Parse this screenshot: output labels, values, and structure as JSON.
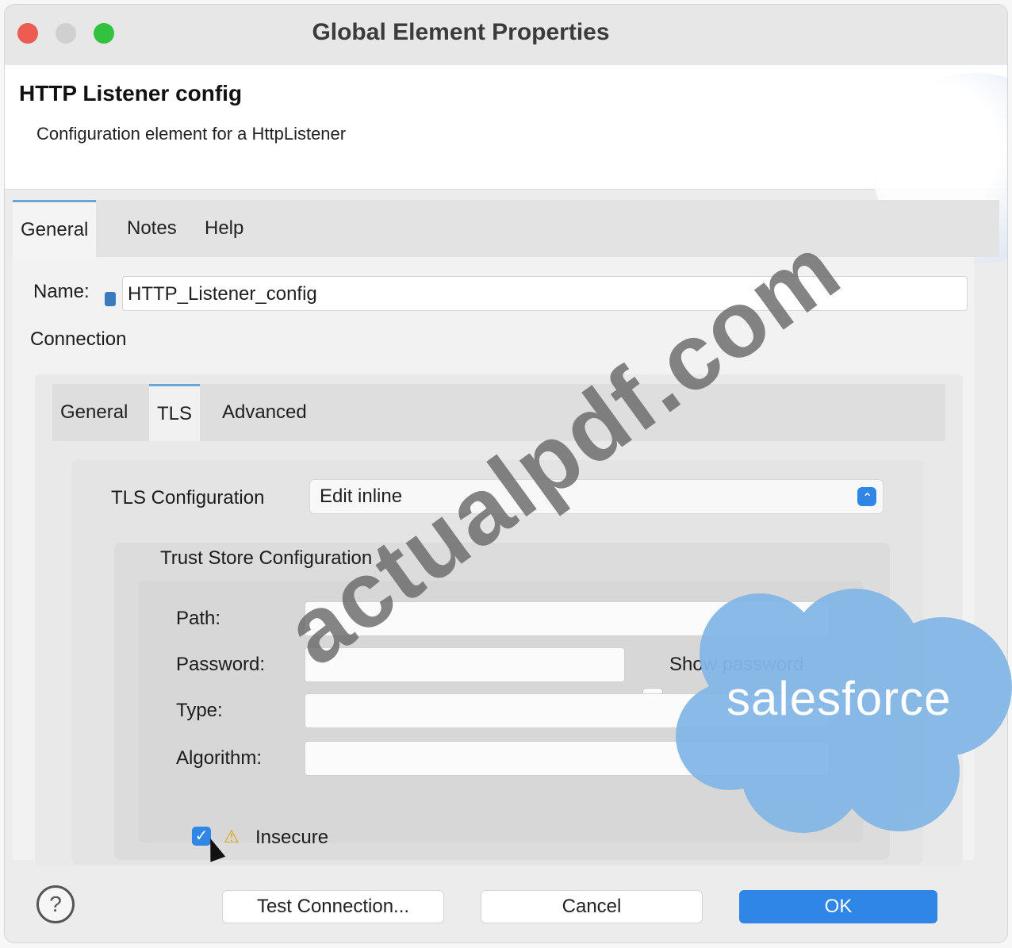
{
  "window": {
    "title": "Global Element Properties"
  },
  "header": {
    "title": "HTTP Listener config",
    "description": "Configuration element for a HttpListener"
  },
  "tabs": [
    "General",
    "Notes",
    "Help"
  ],
  "name_field": {
    "label": "Name:",
    "value": "HTTP_Listener_config"
  },
  "connection": {
    "label": "Connection",
    "tabs": [
      "General",
      "TLS",
      "Advanced"
    ],
    "tls": {
      "config_label": "TLS Configuration",
      "config_value": "Edit inline",
      "trust_store": {
        "title": "Trust Store Configuration",
        "path_label": "Path:",
        "password_label": "Password:",
        "show_password_label": "Show password",
        "type_label": "Type:",
        "algorithm_label": "Algorithm:",
        "insecure_label": "Insecure"
      }
    }
  },
  "footer": {
    "test_connection": "Test Connection...",
    "cancel": "Cancel",
    "ok": "OK",
    "help_symbol": "?"
  },
  "overlays": {
    "watermark": "actualpdf.com",
    "logo": "salesforce"
  }
}
